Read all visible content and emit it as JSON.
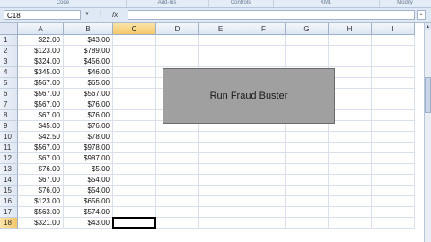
{
  "ribbon": {
    "groups": [
      "Code",
      "Add-Ins",
      "Controls",
      "XML",
      "Modify"
    ]
  },
  "formula_bar": {
    "name_box": "C18",
    "fx_label": "fx",
    "formula": ""
  },
  "sheet": {
    "columns": [
      "A",
      "B",
      "C",
      "D",
      "E",
      "F",
      "G",
      "H",
      "I"
    ],
    "selected_column": "C",
    "selected_row": "18",
    "rows": [
      {
        "n": "1",
        "a": "$22.00",
        "b": "$43.00"
      },
      {
        "n": "2",
        "a": "$123.00",
        "b": "$789.00"
      },
      {
        "n": "3",
        "a": "$324.00",
        "b": "$456.00"
      },
      {
        "n": "4",
        "a": "$345.00",
        "b": "$46.00"
      },
      {
        "n": "5",
        "a": "$567.00",
        "b": "$65.00"
      },
      {
        "n": "6",
        "a": "$567.00",
        "b": "$567.00"
      },
      {
        "n": "7",
        "a": "$567.00",
        "b": "$76.00"
      },
      {
        "n": "8",
        "a": "$67.00",
        "b": "$76.00"
      },
      {
        "n": "9",
        "a": "$45.00",
        "b": "$76.00"
      },
      {
        "n": "10",
        "a": "$42.50",
        "b": "$78.00"
      },
      {
        "n": "11",
        "a": "$567.00",
        "b": "$978.00"
      },
      {
        "n": "12",
        "a": "$67.00",
        "b": "$987.00"
      },
      {
        "n": "13",
        "a": "$76.00",
        "b": "$5.00"
      },
      {
        "n": "14",
        "a": "$67.00",
        "b": "$54.00"
      },
      {
        "n": "15",
        "a": "$76.00",
        "b": "$54.00"
      },
      {
        "n": "16",
        "a": "$123.00",
        "b": "$656.00"
      },
      {
        "n": "17",
        "a": "$563.00",
        "b": "$574.00"
      },
      {
        "n": "18",
        "a": "$321.00",
        "b": "$43.00"
      }
    ]
  },
  "macro_button": {
    "label": "Run Fraud Buster"
  }
}
